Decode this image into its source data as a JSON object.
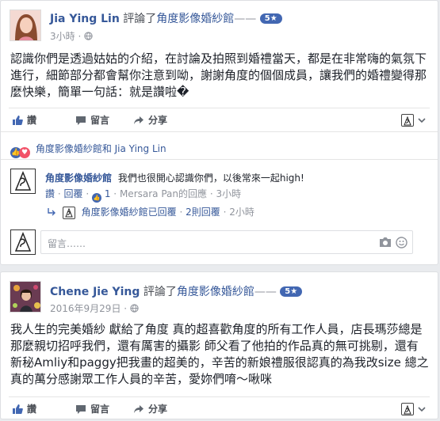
{
  "posts": [
    {
      "author": "Jia Ying Lin",
      "verb": "評論了",
      "page": "角度影像婚紗館",
      "dash": "——",
      "rating": "5★",
      "time": "3小時",
      "text": "認識你們是透過姑姑的介紹，在討論及拍照到婚禮當天，都是在非常嗨的氣氛下進行，細節部分都會幫你注意到呦，謝謝角度的個個成員，讓我們的婚禮變得那麼快樂，簡單一句話：就是讚啦�",
      "actions": {
        "like": "讚",
        "comment": "留言",
        "share": "分享"
      },
      "reactions": "角度影像婚紗館和 Jia Ying Lin",
      "reply": {
        "author": "角度影像婚紗館",
        "text": "我們也很開心認識你們，以後常來一起high!",
        "like": "讚",
        "reply": "回覆",
        "like_count": "1",
        "sep": "·",
        "by": "Mersara Pan的回應",
        "time": "3小時"
      },
      "nested": {
        "page": "角度影像婚紗館已回覆",
        "count": "2則回覆",
        "time": "2小時"
      },
      "composer_placeholder": "留言……"
    },
    {
      "author": "Chene Jie Ying",
      "verb": "評論了",
      "page": "角度影像婚紗館",
      "dash": "——",
      "rating": "5★",
      "time": "2016年9月29日",
      "text": "我人生的完美婚紗 獻給了角度 真的超喜歡角度的所有工作人員，店長瑪莎總是那麼親切招呼我們，還有厲害的攝影 師父看了他拍的作品真的無可挑剔，還有新秘Amliy和paggy把我畫的超美的，辛苦的新娘禮服很認真的為我改size 總之真的萬分感謝眾工作人員的辛苦，愛妳們唷～啾咪",
      "actions": {
        "like": "讚",
        "comment": "留言",
        "share": "分享"
      }
    }
  ],
  "colors": {
    "link": "#365899",
    "accent": "#4267b2",
    "love": "#f25268"
  }
}
